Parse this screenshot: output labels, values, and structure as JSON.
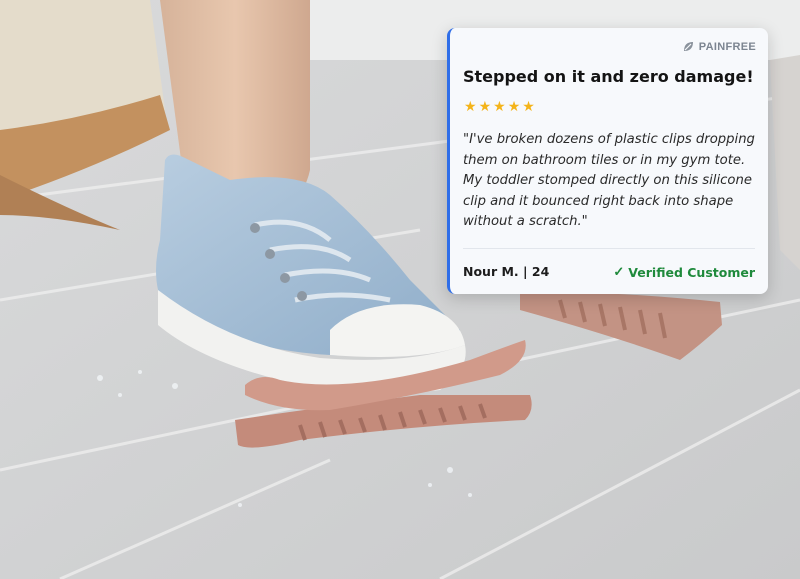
{
  "review": {
    "brand_icon": "leaf-logo-icon",
    "brand_name": "PAINFREE",
    "headline": "Stepped on it and zero damage!",
    "rating": 5,
    "stars": [
      "★",
      "★",
      "★",
      "★",
      "★"
    ],
    "quote": "\"I've broken dozens of plastic clips dropping them on bathroom tiles or in my gym tote. My toddler stomped directly on this silicone clip and it bounced right back into shape without a scratch.\"",
    "reviewer": "Nour M. | 24",
    "verified_icon": "checkmark-icon",
    "verified_label": "Verified Customer"
  },
  "colors": {
    "accent": "#2f6ee8",
    "star": "#f4b41a",
    "verified": "#1f8a3c",
    "clip": "#c88d7e",
    "shoe": "#a9c3db"
  }
}
